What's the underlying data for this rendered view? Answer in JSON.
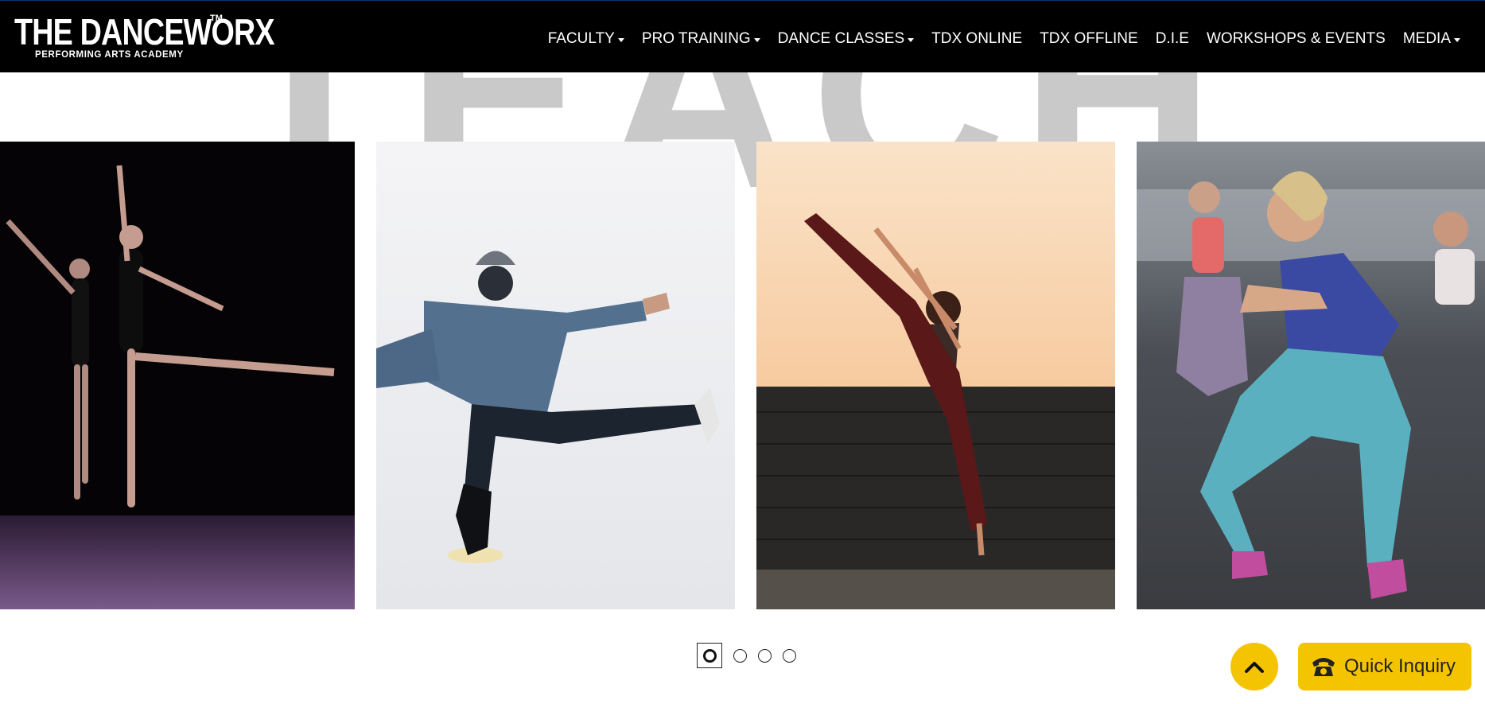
{
  "brand": {
    "name": "THE DANCEWORX",
    "trademark": "TM",
    "tagline": "PERFORMING ARTS ACADEMY"
  },
  "nav": {
    "items": [
      {
        "label": "FACULTY",
        "dropdown": true
      },
      {
        "label": "PRO TRAINING",
        "dropdown": true
      },
      {
        "label": "DANCE CLASSES",
        "dropdown": true
      },
      {
        "label": "TDX ONLINE",
        "dropdown": false
      },
      {
        "label": "TDX OFFLINE",
        "dropdown": false
      },
      {
        "label": "D.I.E",
        "dropdown": false
      },
      {
        "label": "WORKSHOPS & EVENTS",
        "dropdown": false
      },
      {
        "label": "MEDIA",
        "dropdown": true
      }
    ]
  },
  "hero": {
    "watermark_text": "TEACH"
  },
  "carousel": {
    "slides": [
      {
        "subject": "ballet-dancers-photo"
      },
      {
        "subject": "hip-hop-dancer-photo"
      },
      {
        "subject": "contemporary-dancer-sunset-photo"
      },
      {
        "subject": "fitness-class-squat-photo"
      }
    ],
    "pagination": {
      "total": 4,
      "active": 1
    }
  },
  "floating": {
    "quick_inquiry_label": "Quick Inquiry"
  },
  "colors": {
    "nav_bg": "#000000",
    "accent_yellow": "#f5c400",
    "watermark_gray": "#c9c9c9"
  }
}
